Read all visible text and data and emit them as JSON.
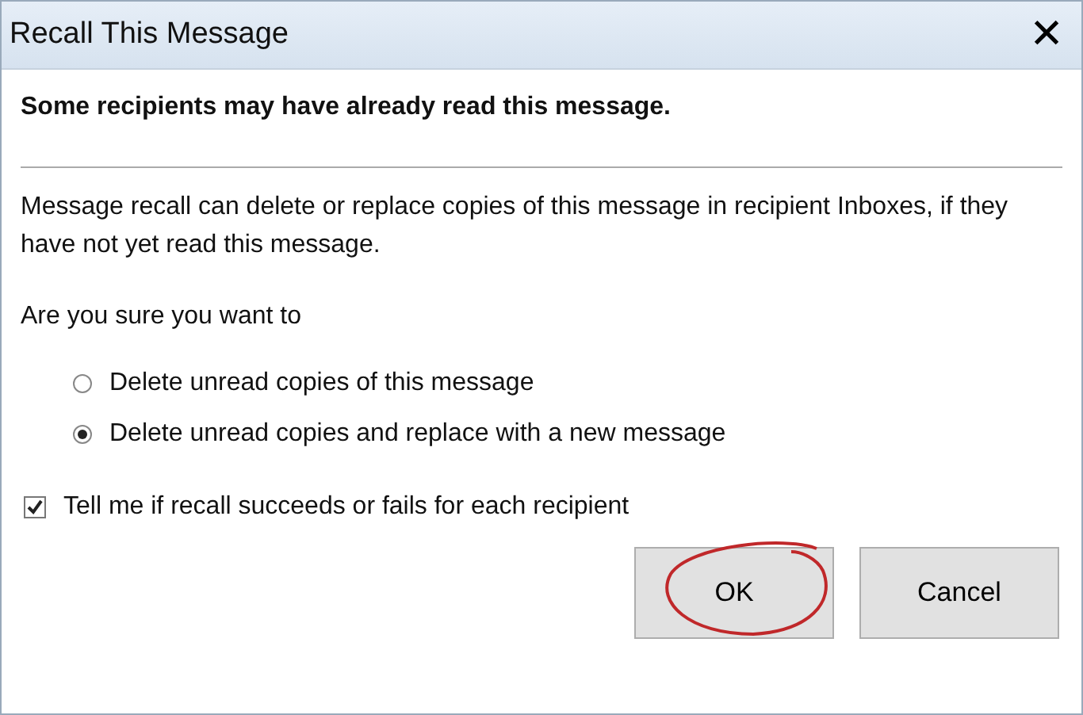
{
  "window": {
    "title": "Recall This Message",
    "close": "✕"
  },
  "heading": "Some recipients may have already read this message.",
  "description": "Message recall can delete or replace copies of this message in recipient Inboxes, if they have not yet read this message.",
  "question": "Are you sure you want to",
  "options": [
    {
      "label": "Delete unread copies of this message",
      "selected": false
    },
    {
      "label": "Delete unread copies and replace with a new message",
      "selected": true
    }
  ],
  "notify": {
    "label": "Tell me if recall succeeds or fails for each recipient",
    "checked": true
  },
  "buttons": [
    {
      "label": "OK",
      "circled": true
    },
    {
      "label": "Cancel",
      "circled": false
    }
  ]
}
